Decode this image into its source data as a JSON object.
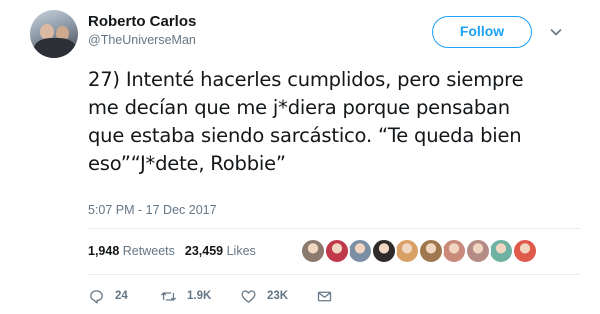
{
  "author": {
    "name": "Roberto Carlos",
    "handle": "@TheUniverseMan"
  },
  "follow_button": {
    "label": "Follow"
  },
  "tweet": {
    "lines": [
      "27) Intenté hacerles cumplidos, pero siempre",
      "me decían que me j*diera porque pensaban",
      "que estaba siendo sarcástico. “Te queda bien",
      "eso”“J*dete, Robbie”"
    ],
    "timestamp": "5:07 PM - 17 Dec 2017"
  },
  "stats": {
    "retweets_count": "1,948",
    "retweets_label": "Retweets",
    "likes_count": "23,459",
    "likes_label": "Likes"
  },
  "liker_avatars": [
    {
      "color": "#8c7a6e"
    },
    {
      "color": "#c0394b"
    },
    {
      "color": "#7d8fa3"
    },
    {
      "color": "#2e2b2a"
    },
    {
      "color": "#d9a066"
    },
    {
      "color": "#a07850"
    },
    {
      "color": "#c98a7a"
    },
    {
      "color": "#b58b86"
    },
    {
      "color": "#6fb2a2"
    },
    {
      "color": "#e05a4b"
    }
  ],
  "actions": {
    "reply_count": "24",
    "retweet_count": "1.9K",
    "like_count": "23K"
  },
  "icons": {
    "reply": "reply-icon",
    "retweet": "retweet-icon",
    "like": "heart-icon",
    "message": "envelope-icon",
    "caret": "chevron-down-icon"
  },
  "colors": {
    "accent": "#1da1f2",
    "secondary_text": "#657786",
    "primary_text": "#14171a",
    "divider": "#e6ecf0"
  }
}
